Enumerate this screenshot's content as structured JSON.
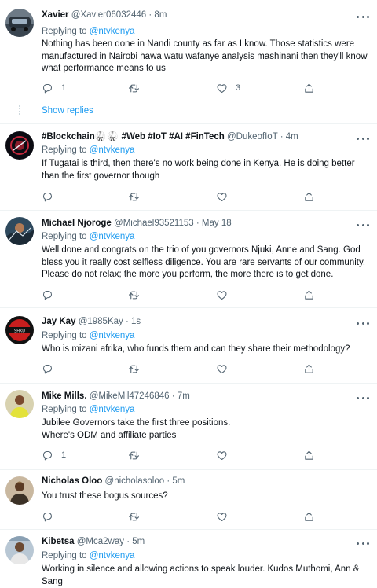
{
  "common": {
    "replying_prefix": "Replying to ",
    "replying_handle": "@ntvkenya",
    "separator": "·"
  },
  "thread": {
    "show_replies_label": "Show replies"
  },
  "tweets": [
    {
      "name": "Xavier",
      "handle": "@Xavier06032446",
      "time": "8m",
      "lines": [
        "Nothing has been done in Nandi county as far as I know. Those statistics were",
        "manufactured in Nairobi hawa watu wafanye analysis mashinani then they'll know",
        "what performance means to us"
      ],
      "reply_count": "1",
      "retweet_count": "",
      "like_count": "3"
    },
    {
      "name": "#Blockchain",
      "name_suffix": "🥋🥋",
      "name_rest": " #Web #IoT #AI #FinTech",
      "handle": "@DukeofIoT",
      "time": "4m",
      "lines": [
        "If Tugatai is third, then there's no work being done in Kenya. He is doing better",
        "than the first governor though"
      ]
    },
    {
      "name": "Michael Njoroge",
      "handle": "@Michael93521153",
      "time": "May 18",
      "lines": [
        "Well done and congrats on the trio of you governors Njuki, Anne and Sang. God",
        "bless you it really cost selfless diligence. You are rare servants of our community.",
        "Please do not relax; the more you perform, the more there is to get done."
      ]
    },
    {
      "name": "Jay Kay",
      "handle": "@1985Kay",
      "time": "1s",
      "lines": [
        "Who is mizani afrika, who funds them and can they share their methodology?"
      ]
    },
    {
      "name": "Mike Mills.",
      "handle": "@MikeMil47246846",
      "time": "7m",
      "lines": [
        "Jubilee Governors take the first three positions.",
        "Where's ODM and affiliate parties"
      ],
      "reply_count": "1"
    },
    {
      "name": "Nicholas Oloo",
      "handle": "@nicholasoloo",
      "time": "5m",
      "lines": [
        "You trust these bogus sources?"
      ]
    },
    {
      "name": "Kibetsa",
      "handle": "@Mca2way",
      "time": "5m",
      "lines": [
        "Working in silence and allowing actions to speak louder. Kudos Muthomi, Ann &",
        "Sang"
      ]
    }
  ],
  "icons": {
    "reply": "reply-icon",
    "retweet": "retweet-icon",
    "like": "heart-icon",
    "share": "share-icon",
    "more": "more-icon"
  },
  "colors": {
    "link": "#1d9bf0",
    "secondary_text": "#536471",
    "primary_text": "#0f1419",
    "divider": "#eff3f4"
  }
}
